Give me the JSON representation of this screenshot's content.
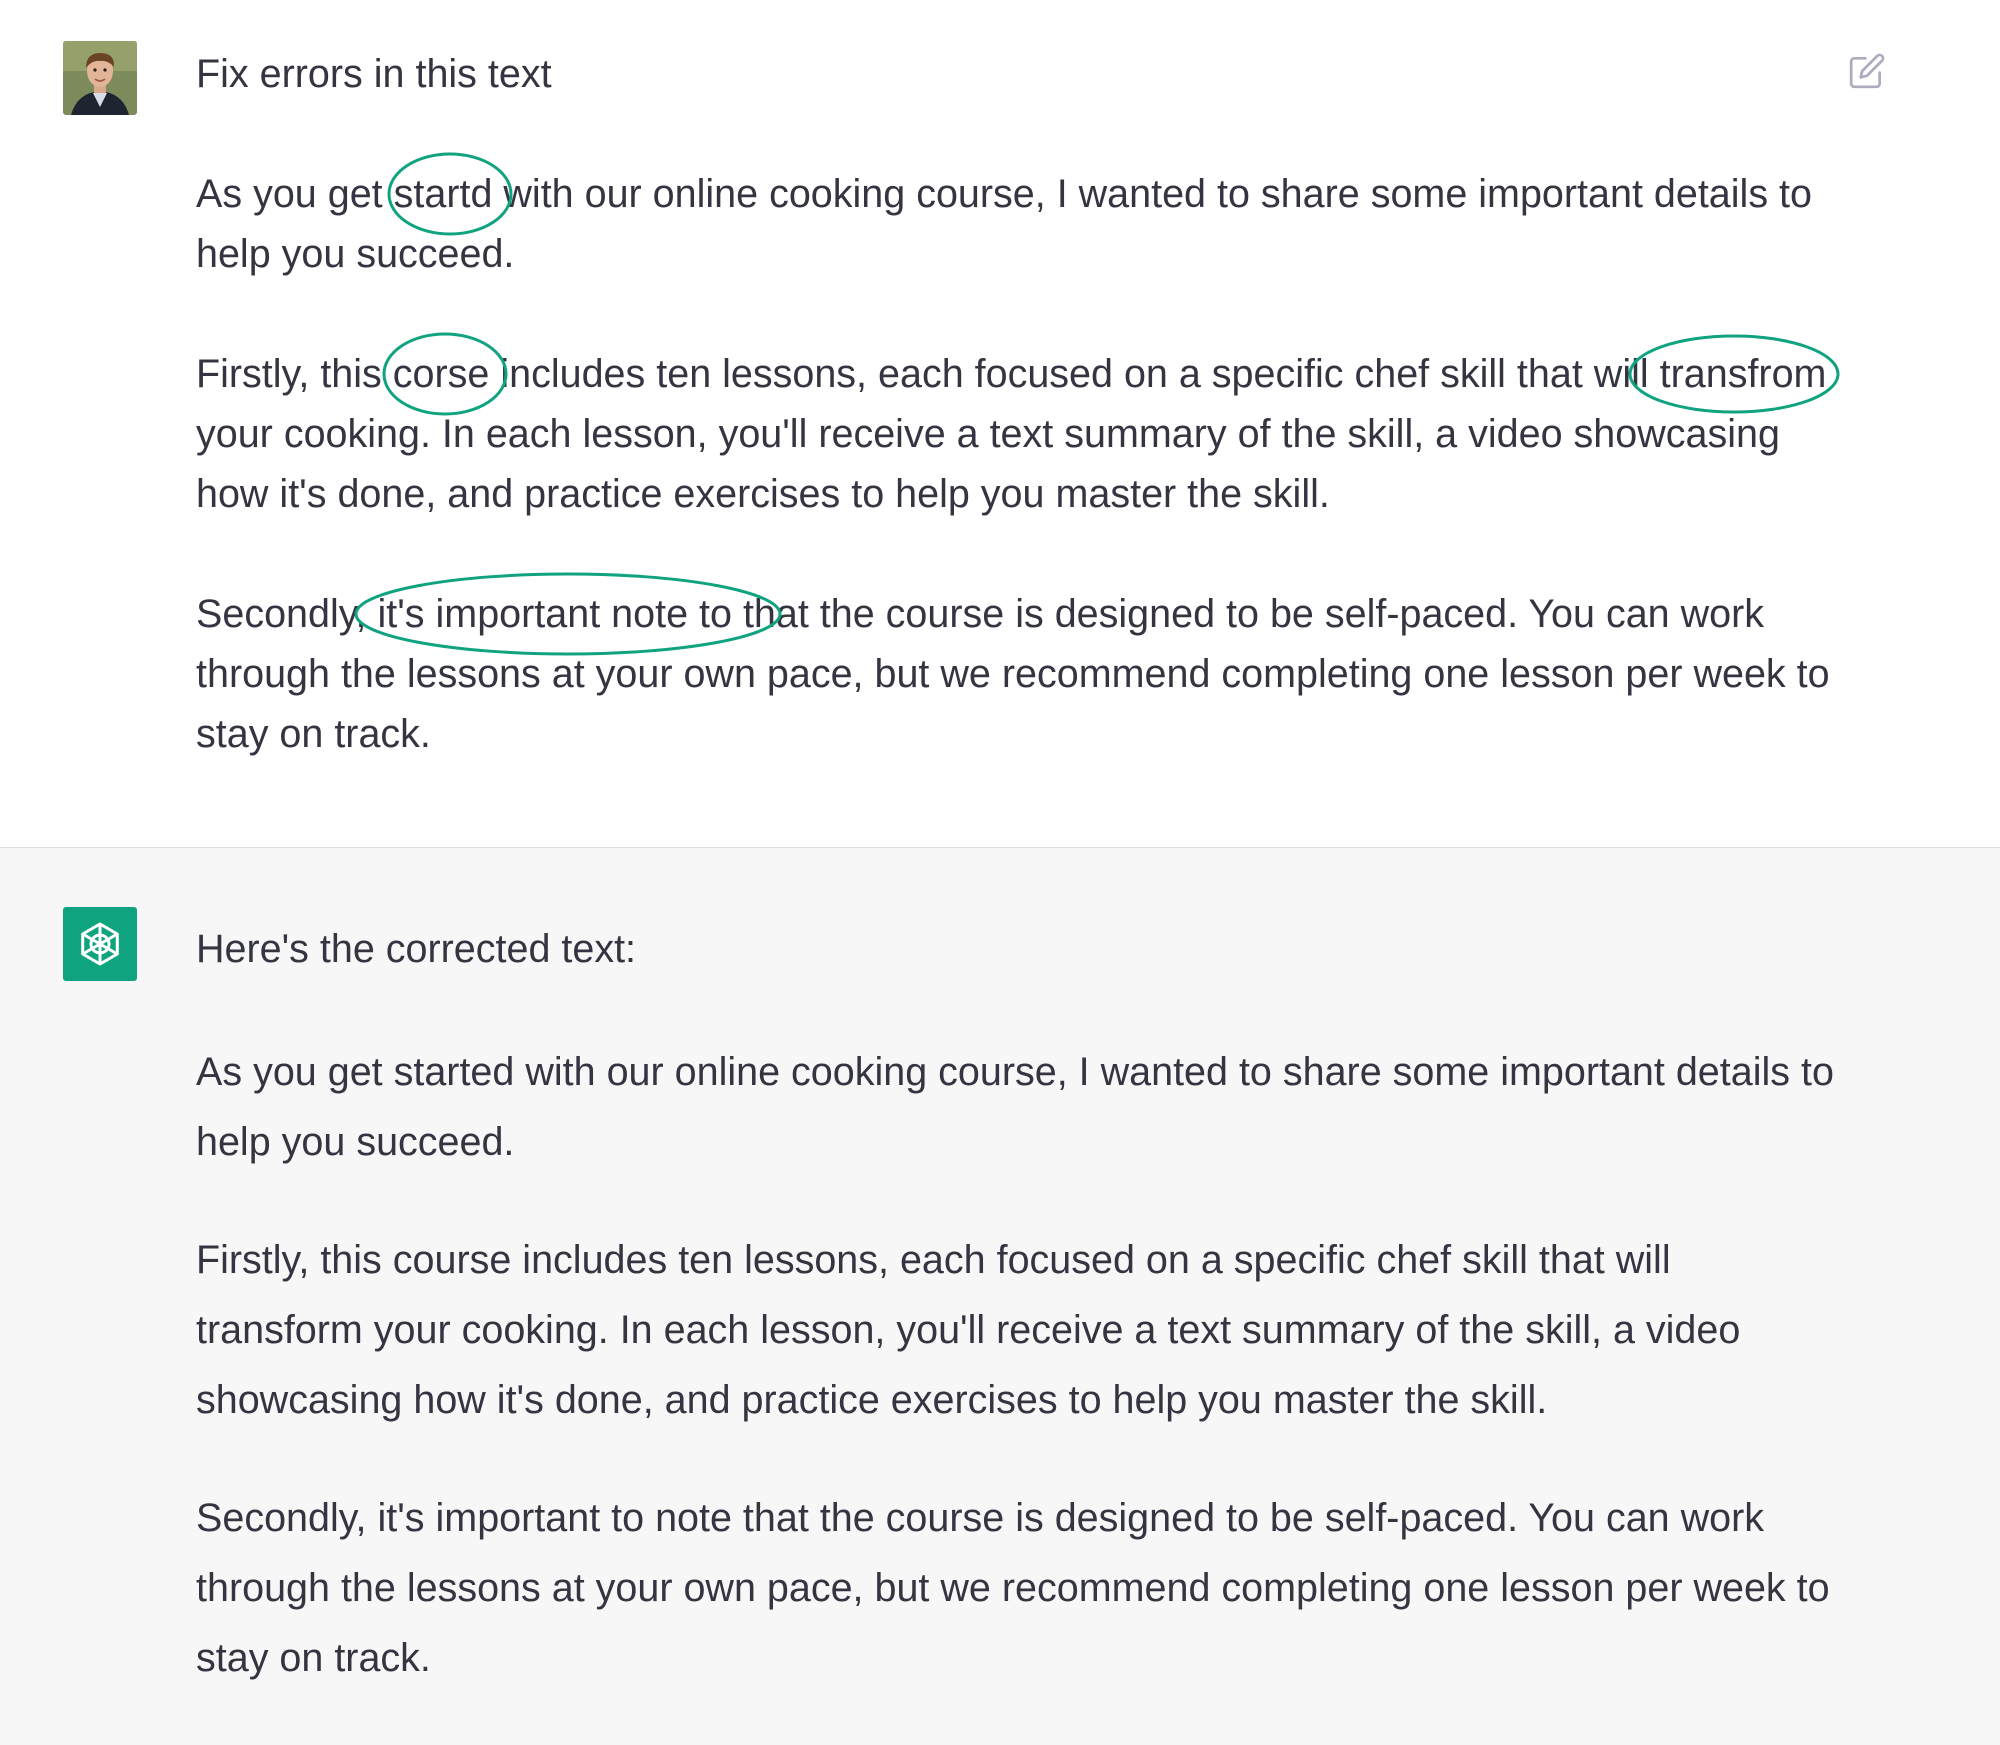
{
  "user_message": {
    "prompt": "Fix errors in this text",
    "paragraphs": [
      {
        "before": "As you get ",
        "mark1": "startd",
        "after": " with our online cooking course, I wanted to share some important details to help you succeed."
      },
      {
        "before": "Firstly, this ",
        "mark1": "corse",
        "middle": " includes ten lessons, each focused on a specific chef skill that will ",
        "mark2": "transfrom",
        "after": " your cooking. In each lesson, you'll receive a text summary of the skill, a video showcasing how it's done, and practice exercises to help you master the skill."
      },
      {
        "before": "Secondly, ",
        "mark1": "it's important note to",
        "after": " that the course is designed to be self-paced. You can work through the lessons at your own pace, but we recommend completing one lesson per week to stay on track."
      }
    ],
    "annotation_color": "#10a37f"
  },
  "assistant_message": {
    "intro": "Here's the corrected text:",
    "paragraphs": [
      "As you get started with our online cooking course, I wanted to share some important details to help you succeed.",
      "Firstly, this course includes ten lessons, each focused on a specific chef skill that will transform your cooking. In each lesson, you'll receive a text summary of the skill, a video showcasing how it's done, and practice exercises to help you master the skill.",
      "Secondly, it's important to note that the course is designed to be self-paced. You can work through the lessons at your own pace, but we recommend completing one lesson per week to stay on track."
    ]
  },
  "icons": {
    "edit": "edit-icon",
    "thumbs_up": "thumbs-up-icon",
    "thumbs_down": "thumbs-down-icon",
    "assistant_logo": "openai-logo-icon"
  },
  "colors": {
    "accent": "#10a37f",
    "assistant_bg": "#f7f7f8",
    "text": "#343541",
    "icon": "#acacbe"
  }
}
